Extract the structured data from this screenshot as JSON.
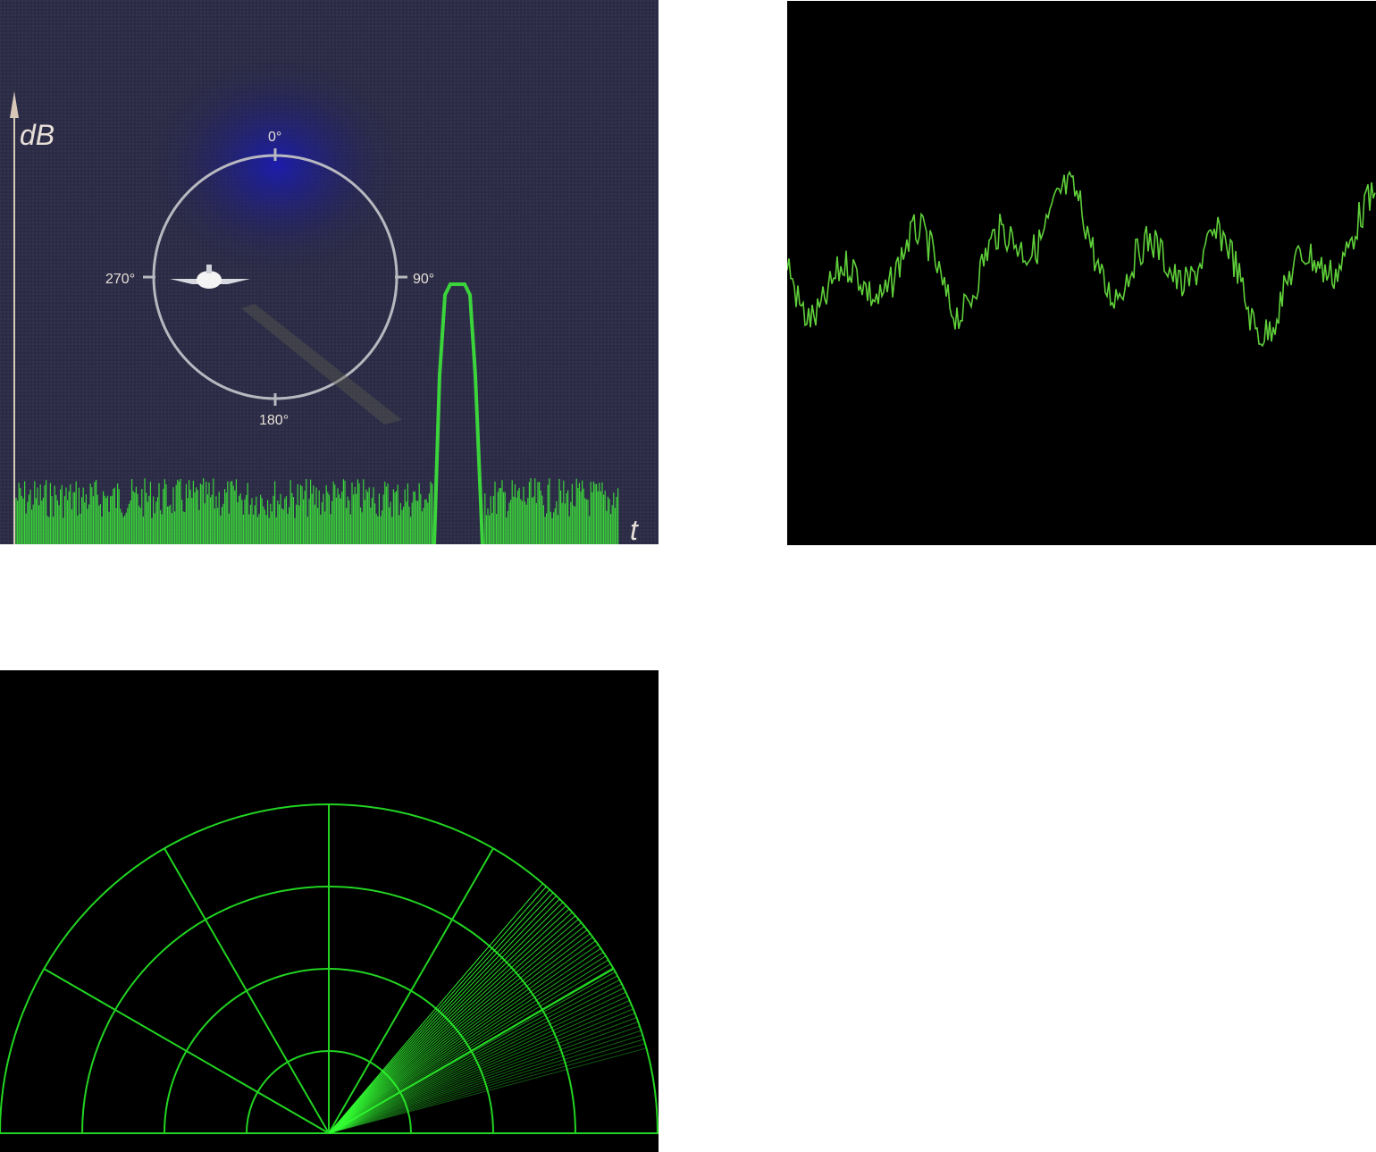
{
  "radar_lobe_panel": {
    "y_axis_label": "dB",
    "x_axis_label": "t",
    "compass": {
      "north": "0°",
      "east": "90°",
      "south": "180°",
      "west": "270°"
    },
    "colors": {
      "background": "#2a2a44",
      "signal": "#3bd43b",
      "glow": "#1a1aa0",
      "ring": "#b8b8c0"
    }
  },
  "waveform_panel": {
    "colors": {
      "background": "#000000",
      "signal": "#5fcf3a"
    }
  },
  "sweep_panel": {
    "colors": {
      "background": "#000000",
      "grid": "#22d422",
      "sweep": "#33ff33"
    }
  }
}
